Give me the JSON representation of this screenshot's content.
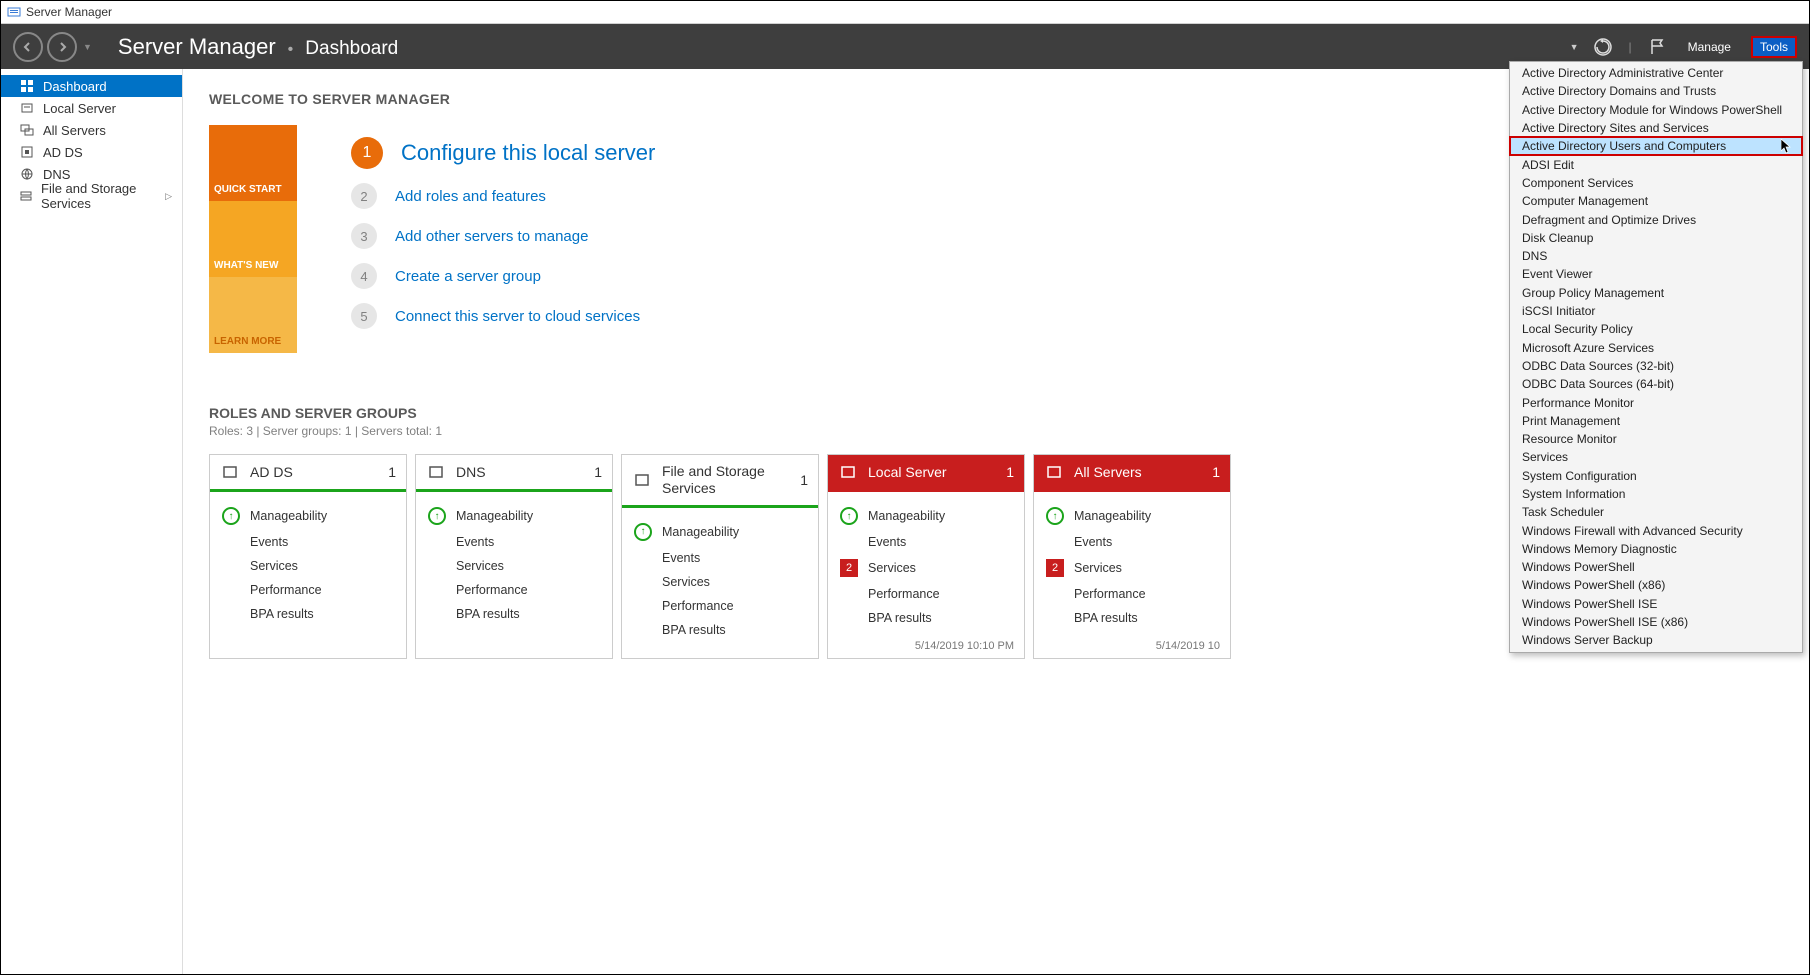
{
  "titlebar": {
    "title": "Server Manager"
  },
  "header": {
    "breadcrumb_main": "Server Manager",
    "breadcrumb_sub": "Dashboard",
    "manage": "Manage",
    "tools": "Tools"
  },
  "sidebar": {
    "items": [
      {
        "label": "Dashboard"
      },
      {
        "label": "Local Server"
      },
      {
        "label": "All Servers"
      },
      {
        "label": "AD DS"
      },
      {
        "label": "DNS"
      },
      {
        "label": "File and Storage Services"
      }
    ]
  },
  "welcome": {
    "title": "WELCOME TO SERVER MANAGER",
    "tabs": {
      "quick_start": "QUICK START",
      "whats_new": "WHAT'S NEW",
      "learn_more": "LEARN MORE"
    },
    "links": [
      {
        "num": "1",
        "label": "Configure this local server"
      },
      {
        "num": "2",
        "label": "Add roles and features"
      },
      {
        "num": "3",
        "label": "Add other servers to manage"
      },
      {
        "num": "4",
        "label": "Create a server group"
      },
      {
        "num": "5",
        "label": "Connect this server to cloud services"
      }
    ]
  },
  "groups": {
    "title": "ROLES AND SERVER GROUPS",
    "subtitle": "Roles: 3   |   Server groups: 1   |   Servers total: 1",
    "tiles": [
      {
        "title": "AD DS",
        "count": "1",
        "red": false,
        "rows": [
          {
            "kind": "ok",
            "label": "Manageability"
          },
          {
            "kind": "plain",
            "label": "Events"
          },
          {
            "kind": "plain",
            "label": "Services"
          },
          {
            "kind": "plain",
            "label": "Performance"
          },
          {
            "kind": "plain",
            "label": "BPA results"
          }
        ],
        "timestamp": ""
      },
      {
        "title": "DNS",
        "count": "1",
        "red": false,
        "rows": [
          {
            "kind": "ok",
            "label": "Manageability"
          },
          {
            "kind": "plain",
            "label": "Events"
          },
          {
            "kind": "plain",
            "label": "Services"
          },
          {
            "kind": "plain",
            "label": "Performance"
          },
          {
            "kind": "plain",
            "label": "BPA results"
          }
        ],
        "timestamp": ""
      },
      {
        "title": "File and Storage Services",
        "count": "1",
        "red": false,
        "rows": [
          {
            "kind": "ok",
            "label": "Manageability"
          },
          {
            "kind": "plain",
            "label": "Events"
          },
          {
            "kind": "plain",
            "label": "Services"
          },
          {
            "kind": "plain",
            "label": "Performance"
          },
          {
            "kind": "plain",
            "label": "BPA results"
          }
        ],
        "timestamp": ""
      },
      {
        "title": "Local Server",
        "count": "1",
        "red": true,
        "rows": [
          {
            "kind": "ok",
            "label": "Manageability"
          },
          {
            "kind": "plain",
            "label": "Events"
          },
          {
            "kind": "alert",
            "badge": "2",
            "label": "Services"
          },
          {
            "kind": "plain",
            "label": "Performance"
          },
          {
            "kind": "plain",
            "label": "BPA results"
          }
        ],
        "timestamp": "5/14/2019 10:10 PM"
      },
      {
        "title": "All Servers",
        "count": "1",
        "red": true,
        "rows": [
          {
            "kind": "ok",
            "label": "Manageability"
          },
          {
            "kind": "plain",
            "label": "Events"
          },
          {
            "kind": "alert",
            "badge": "2",
            "label": "Services"
          },
          {
            "kind": "plain",
            "label": "Performance"
          },
          {
            "kind": "plain",
            "label": "BPA results"
          }
        ],
        "timestamp": "5/14/2019 10"
      }
    ]
  },
  "tools_menu": {
    "highlighted_index": 4,
    "items": [
      "Active Directory Administrative Center",
      "Active Directory Domains and Trusts",
      "Active Directory Module for Windows PowerShell",
      "Active Directory Sites and Services",
      "Active Directory Users and Computers",
      "ADSI Edit",
      "Component Services",
      "Computer Management",
      "Defragment and Optimize Drives",
      "Disk Cleanup",
      "DNS",
      "Event Viewer",
      "Group Policy Management",
      "iSCSI Initiator",
      "Local Security Policy",
      "Microsoft Azure Services",
      "ODBC Data Sources (32-bit)",
      "ODBC Data Sources (64-bit)",
      "Performance Monitor",
      "Print Management",
      "Resource Monitor",
      "Services",
      "System Configuration",
      "System Information",
      "Task Scheduler",
      "Windows Firewall with Advanced Security",
      "Windows Memory Diagnostic",
      "Windows PowerShell",
      "Windows PowerShell (x86)",
      "Windows PowerShell ISE",
      "Windows PowerShell ISE (x86)",
      "Windows Server Backup"
    ]
  }
}
